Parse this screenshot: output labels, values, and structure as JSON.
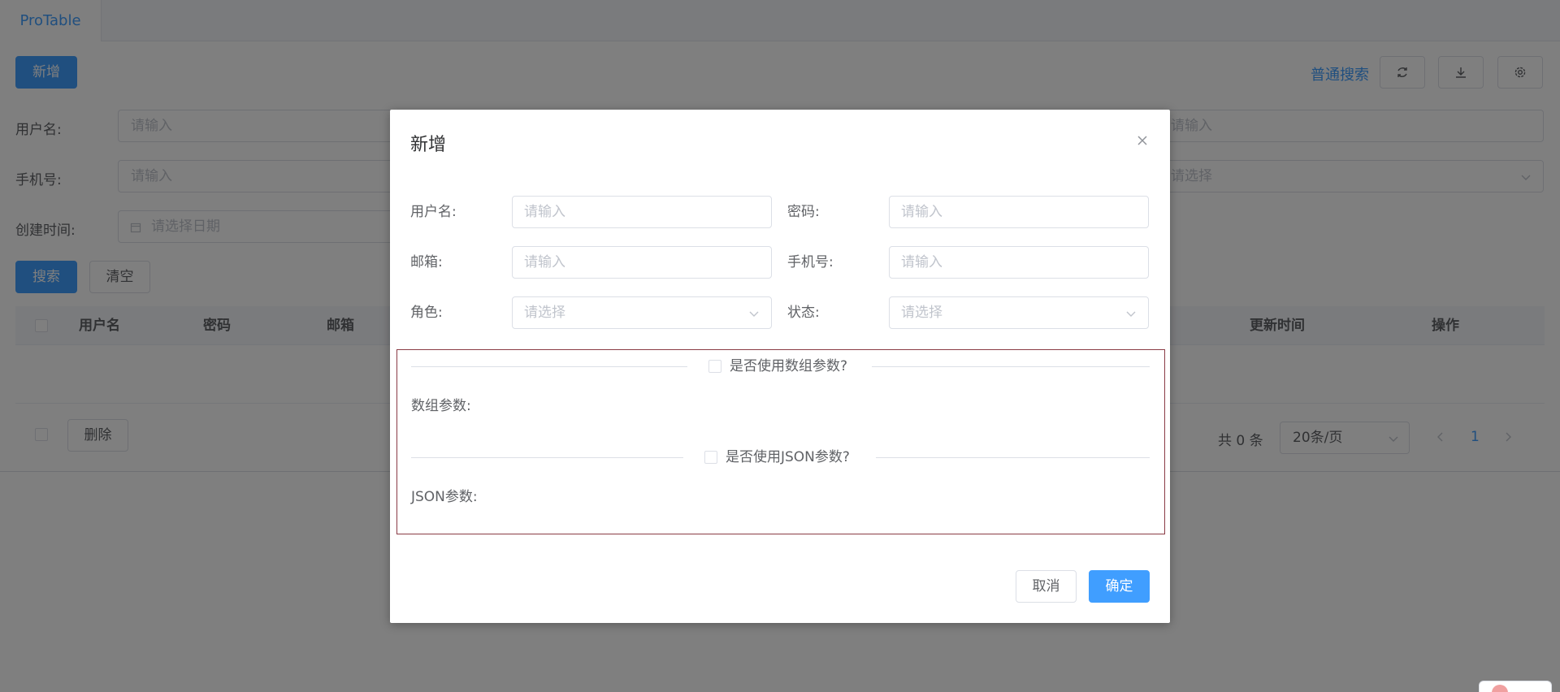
{
  "tab": {
    "label": "ProTable"
  },
  "toolbar": {
    "add_label": "新增",
    "search_mode_label": "普通搜索",
    "refresh_icon": "refresh-icon",
    "download_icon": "download-icon",
    "settings_icon": "gear-icon"
  },
  "search_form": {
    "username_label": "用户名:",
    "username_placeholder": "请输入",
    "phone_label": "手机号:",
    "phone_placeholder": "请输入",
    "created_label": "创建时间:",
    "created_placeholder": "请选择日期",
    "right_input_placeholder": "请输入",
    "right_select_placeholder": "请选择",
    "search_label": "搜索",
    "clear_label": "清空"
  },
  "table": {
    "columns": [
      "用户名",
      "密码",
      "邮箱",
      "更新时间",
      "操作"
    ]
  },
  "footer": {
    "delete_label": "删除",
    "total_text": "共 0 条",
    "page_size": "20条/页",
    "current_page": "1"
  },
  "dialog": {
    "title": "新增",
    "fields": {
      "username": {
        "label": "用户名:",
        "placeholder": "请输入"
      },
      "password": {
        "label": "密码:",
        "placeholder": "请输入"
      },
      "email": {
        "label": "邮箱:",
        "placeholder": "请输入"
      },
      "phone": {
        "label": "手机号:",
        "placeholder": "请输入"
      },
      "role": {
        "label": "角色:",
        "placeholder": "请选择"
      },
      "status": {
        "label": "状态:",
        "placeholder": "请选择"
      }
    },
    "array_toggle_label": "是否使用数组参数?",
    "array_params_label": "数组参数:",
    "json_toggle_label": "是否使用JSON参数?",
    "json_params_label": "JSON参数:",
    "cancel_label": "取消",
    "confirm_label": "确定"
  },
  "colors": {
    "primary": "#409eff",
    "overlay": "rgba(0,0,0,0.5)",
    "params_border": "#8a3b45"
  }
}
